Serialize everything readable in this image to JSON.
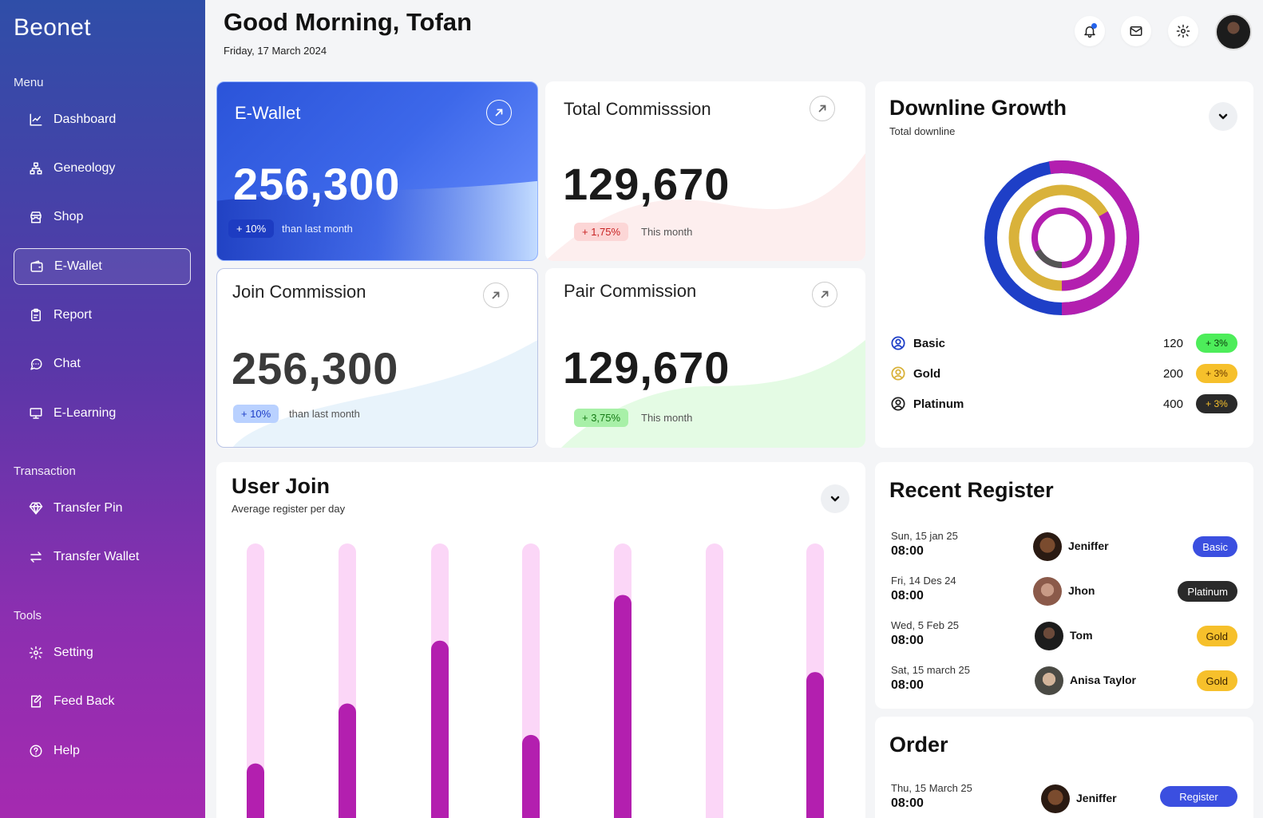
{
  "sidebar": {
    "brand": "Beonet",
    "sections": {
      "menu": "Menu",
      "transaction": "Transaction",
      "tools": "Tools"
    },
    "items": [
      {
        "label": "Dashboard",
        "icon": "chart-line-icon"
      },
      {
        "label": "Geneology",
        "icon": "sitemap-icon"
      },
      {
        "label": "Shop",
        "icon": "store-icon"
      },
      {
        "label": "E-Wallet",
        "icon": "wallet-icon",
        "active": true
      },
      {
        "label": "Report",
        "icon": "clipboard-icon"
      },
      {
        "label": "Chat",
        "icon": "chat-bubble-icon"
      },
      {
        "label": "E-Learning",
        "icon": "monitor-icon"
      },
      {
        "label": "Transfer Pin",
        "icon": "diamond-icon"
      },
      {
        "label": "Transfer Wallet",
        "icon": "swap-arrows-icon"
      },
      {
        "label": "Setting",
        "icon": "gear-icon"
      },
      {
        "label": "Feed Back",
        "icon": "edit-note-icon"
      },
      {
        "label": "Help",
        "icon": "help-circle-icon"
      }
    ]
  },
  "header": {
    "greeting": "Good Morning, Tofan",
    "date": "Friday, 17 March  2024",
    "icons": [
      "bell-icon",
      "mail-icon",
      "gear-icon"
    ]
  },
  "cards": {
    "ewallet": {
      "title": "E-Wallet",
      "value": "256,300",
      "badge": "+ 10%",
      "sub": "than last month"
    },
    "total": {
      "title": "Total Commisssion",
      "value": "129,670",
      "badge": "+ 1,75%",
      "sub": "This month"
    },
    "join": {
      "title": "Join Commission",
      "value": "256,300",
      "badge": "+ 10%",
      "sub": "than last month"
    },
    "pair": {
      "title": "Pair Commission",
      "value": "129,670",
      "badge": "+ 3,75%",
      "sub": "This month"
    }
  },
  "downline": {
    "title": "Downline Growth",
    "subtitle": "Total downline",
    "rows": [
      {
        "name": "Basic",
        "value": "120",
        "badge": "+ 3%",
        "color": "#1e3fc7"
      },
      {
        "name": "Gold",
        "value": "200",
        "badge": "+ 3%",
        "color": "#d9b23a"
      },
      {
        "name": "Platinum",
        "value": "400",
        "badge": "+ 3%",
        "color": "#222222"
      }
    ]
  },
  "user_join": {
    "title": "User Join",
    "subtitle": "Average register per day",
    "bar_fill_fractions": [
      0.23,
      0.44,
      0.66,
      0.33,
      0.82,
      0.0,
      0.55
    ],
    "colors": {
      "track": "#fbd6f7",
      "fill": "#b31faf"
    }
  },
  "recent": {
    "title": "Recent Register",
    "rows": [
      {
        "date": "Sun, 15 jan 25",
        "time": "08:00",
        "name": "Jeniffer",
        "badge": "Basic"
      },
      {
        "date": "Fri, 14 Des 24",
        "time": "08:00",
        "name": "Jhon",
        "badge": "Platinum"
      },
      {
        "date": "Wed, 5 Feb 25",
        "time": "08:00",
        "name": "Tom",
        "badge": "Gold"
      },
      {
        "date": "Sat, 15 march  25",
        "time": "08:00",
        "name": "Anisa Taylor",
        "badge": "Gold"
      }
    ]
  },
  "order": {
    "title": "Order",
    "rows": [
      {
        "date": "Thu, 15 March 25",
        "time": "08:00",
        "name": "Jeniffer",
        "badge": "Register"
      }
    ]
  }
}
